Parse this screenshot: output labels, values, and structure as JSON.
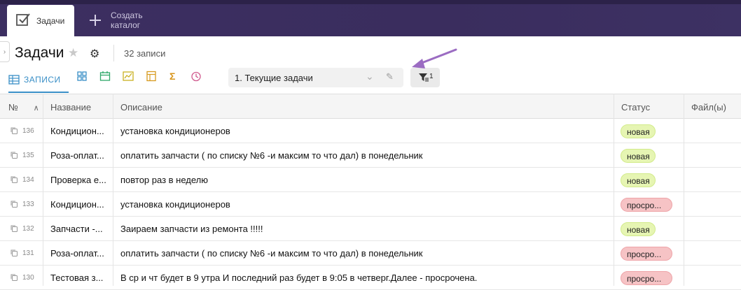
{
  "tabs": {
    "active_label": "Задачи",
    "new_label": "Создать каталог"
  },
  "header": {
    "title": "Задачи",
    "record_count": "32 записи"
  },
  "views": {
    "records_label": "ЗАПИСИ",
    "filter_label": "1. Текущие задачи",
    "filter_count": "1"
  },
  "table": {
    "columns": [
      "№",
      "Название",
      "Описание",
      "Статус",
      "Файл(ы)"
    ],
    "rows": [
      {
        "id": "136",
        "name": "Кондицион...",
        "desc": "установка кондиционеров",
        "status": "новая",
        "status_type": "new"
      },
      {
        "id": "135",
        "name": "Роза-оплат...",
        "desc": "оплатить запчасти ( по списку №6 -и максим то что дал) в понедельник",
        "status": "новая",
        "status_type": "new"
      },
      {
        "id": "134",
        "name": "Проверка е...",
        "desc": "повтор раз в неделю",
        "status": "новая",
        "status_type": "new"
      },
      {
        "id": "133",
        "name": "Кондицион...",
        "desc": "установка кондиционеров",
        "status": "просро...",
        "status_type": "overdue"
      },
      {
        "id": "132",
        "name": "Запчасти -...",
        "desc": "Заиpaем запчасти из ремонта !!!!!",
        "status": "новая",
        "status_type": "new"
      },
      {
        "id": "131",
        "name": "Роза-оплат...",
        "desc": "оплатить запчасти ( по списку №6 -и максим то что дал) в понедельник",
        "status": "просро...",
        "status_type": "overdue"
      },
      {
        "id": "130",
        "name": "Тестовая з...",
        "desc": "В ср и чт будет в 9 утра И последний раз будет в 9:05 в четверг.Далее - просрочена.",
        "status": "просро...",
        "status_type": "overdue"
      }
    ]
  },
  "colors": {
    "topbar": "#3c2f61",
    "accent": "#3a8fc7",
    "arrow": "#9b6cc2",
    "badge_new": "#e6f5b3",
    "badge_overdue": "#f6c3c5"
  }
}
